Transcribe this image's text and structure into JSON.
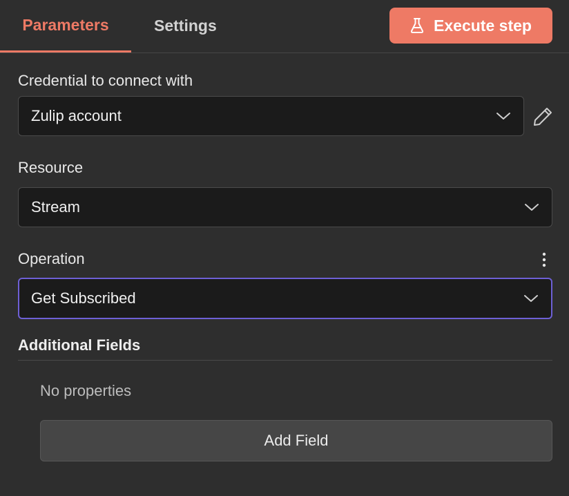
{
  "tabs": {
    "parameters_label": "Parameters",
    "settings_label": "Settings"
  },
  "execute_button": {
    "label": "Execute step",
    "icon": "flask-icon"
  },
  "credential": {
    "label": "Credential to connect with",
    "value": "Zulip account"
  },
  "resource": {
    "label": "Resource",
    "value": "Stream"
  },
  "operation": {
    "label": "Operation",
    "value": "Get Subscribed"
  },
  "additional_fields": {
    "title": "Additional Fields",
    "empty_text": "No properties",
    "add_button_label": "Add Field"
  },
  "colors": {
    "accent": "#ee7a65",
    "focus_border": "#6e60d6",
    "background": "#2e2e2e",
    "input_background": "#1b1b1b"
  }
}
